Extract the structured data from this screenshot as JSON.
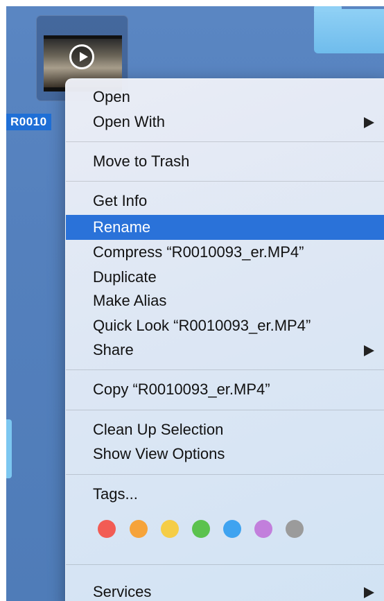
{
  "desktop": {
    "file": {
      "label": "R0010",
      "thumbnail_icon": "play-icon"
    },
    "folder_icon": "folder-icon"
  },
  "menu": {
    "open": "Open",
    "open_with": "Open With",
    "move_to_trash": "Move to Trash",
    "get_info": "Get Info",
    "rename": "Rename",
    "compress": "Compress “R0010093_er.MP4”",
    "duplicate": "Duplicate",
    "make_alias": "Make Alias",
    "quick_look": "Quick Look “R0010093_er.MP4”",
    "share": "Share",
    "copy": "Copy “R0010093_er.MP4”",
    "clean_up_selection": "Clean Up Selection",
    "show_view_options": "Show View Options",
    "tags": "Tags...",
    "services": "Services",
    "highlighted_item": "Rename",
    "highlight_color": "#2a72d9"
  },
  "tag_colors": [
    {
      "name": "red",
      "color": "#f25c54"
    },
    {
      "name": "orange",
      "color": "#f6a33a"
    },
    {
      "name": "yellow",
      "color": "#f5cd47"
    },
    {
      "name": "green",
      "color": "#5bc24e"
    },
    {
      "name": "blue",
      "color": "#3fa3f0"
    },
    {
      "name": "purple",
      "color": "#c27fdc"
    },
    {
      "name": "gray",
      "color": "#9b9b9b"
    }
  ]
}
